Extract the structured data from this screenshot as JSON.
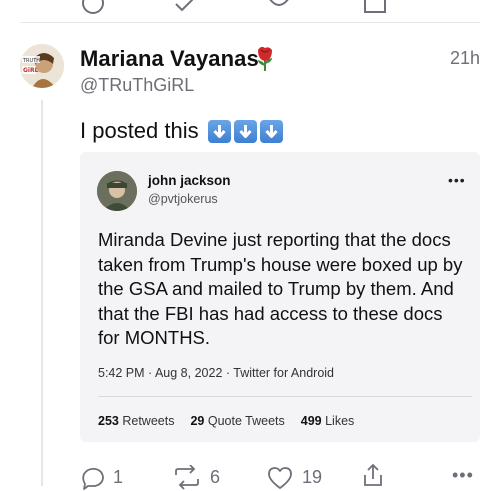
{
  "tweet": {
    "author_name": "Mariana Vayanas",
    "author_handle": "@TRuThGiRL",
    "time": "21h",
    "text": "I posted this",
    "text_emoji": "down-arrow-button x3",
    "emoji_after_name": "rose"
  },
  "embedded_tweet": {
    "author_name": "john jackson",
    "author_handle": "@pvtjokerus",
    "more_label": "•••",
    "body": "Miranda Devine just reporting that the docs taken from Trump's house were boxed up by the GSA and mailed to Trump by them. And that the FBI has had access to these docs for MONTHS.",
    "meta": "5:42 PM · Aug 8, 2022 · Twitter for Android",
    "retweets_count": "253",
    "retweets_label": "Retweets",
    "quote_count": "29",
    "quote_label": "Quote Tweets",
    "likes_count": "499",
    "likes_label": "Likes"
  },
  "actions": {
    "replies": "1",
    "reposts": "6",
    "likes": "19",
    "more_label": "•••"
  },
  "colors": {
    "text": "#111111",
    "muted": "#6e6e78",
    "divider": "#e6e6eb",
    "emoji_blue": "#4a8ad8"
  }
}
